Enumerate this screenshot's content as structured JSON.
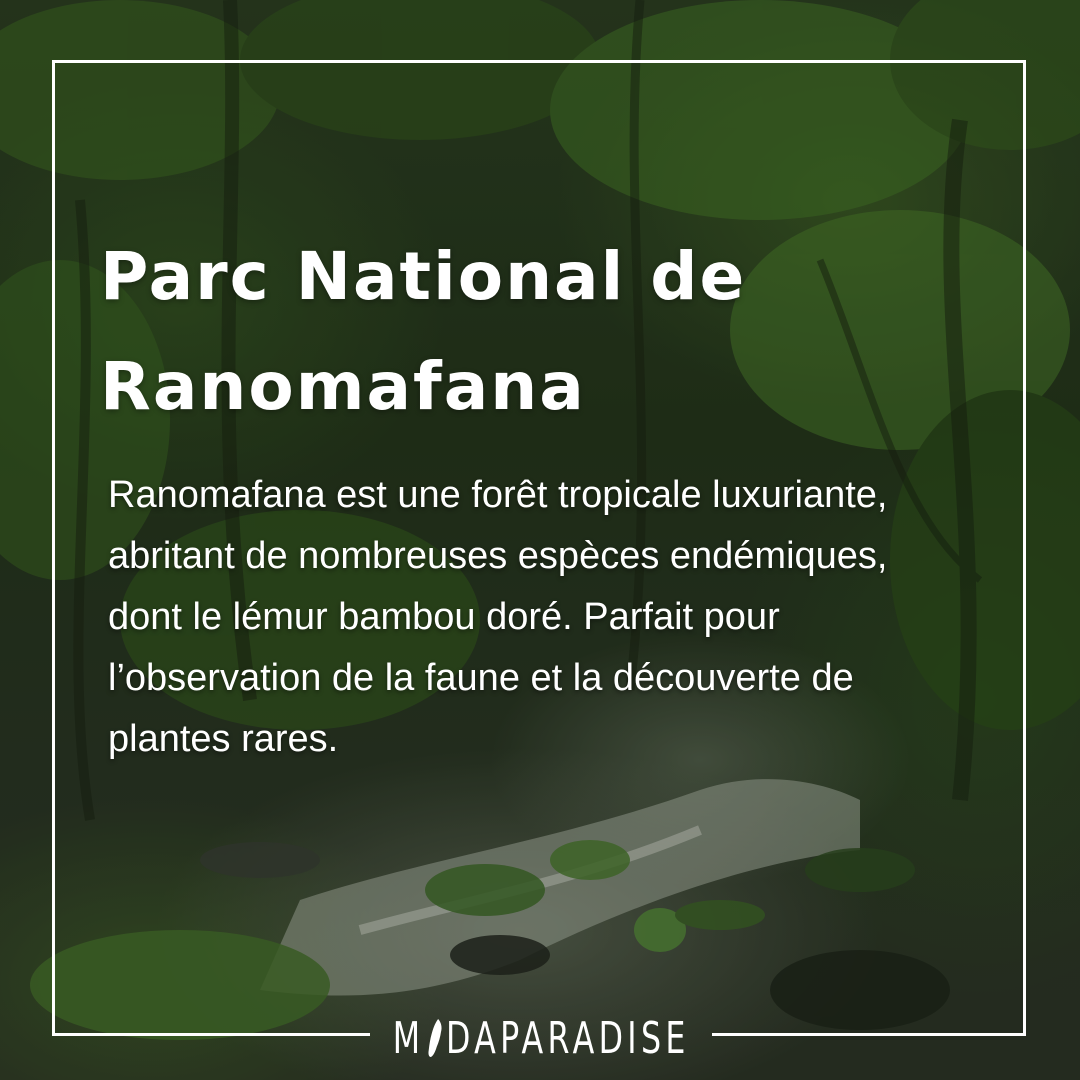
{
  "post": {
    "title": "Parc National de\nRanomafana",
    "description": "Ranomafana est une forêt tropicale luxuriante, abritant de nombreuses espèces endémiques, dont le lémur bambou doré. Parfait pour l’observation de la faune et la découverte de plantes rares.",
    "brand_logo_text": "MADAPARADISE",
    "brand_part_1": "M",
    "brand_part_2": "DAPARADISE",
    "brand_mark_icon": "madagascar-island-icon",
    "background_image": "rainforest-stream-photo"
  },
  "colors": {
    "text": "#ffffff",
    "frame": "#ffffff",
    "forest_dark": "#25361c",
    "forest_green": "#4e7a2c",
    "water": "#b9c2b4"
  }
}
